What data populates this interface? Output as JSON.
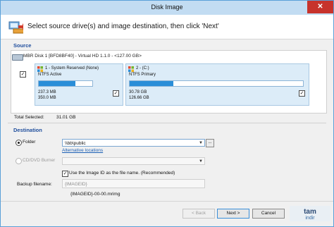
{
  "window": {
    "title": "Disk Image",
    "close_glyph": "✕"
  },
  "header": {
    "instruction": "Select source drive(s) and image destination, then click 'Next'",
    "icon": "wizard-icon"
  },
  "source": {
    "section_label": "Source",
    "disk": {
      "label": "MBR Disk 1 [BFD8BF40] - Virtual HD 1.1.0  -  <127.00 GB>",
      "checked": true
    },
    "partitions": [
      {
        "name": "1 - System Reserved (None)",
        "fs": "NTFS Active",
        "used": "237.3 MB",
        "total": "350.0 MB",
        "fill_percent": 68,
        "checked": true
      },
      {
        "name": "2 - (C:)",
        "fs": "NTFS Primary",
        "used": "30.78 GB",
        "total": "126.66 GB",
        "fill_percent": 25,
        "checked": true
      }
    ],
    "total_selected_label": "Total Selected:",
    "total_selected_value": "31.01 GB"
  },
  "destination": {
    "section_label": "Destination",
    "folder_label": "Folder",
    "folder_value": "\\\\bb\\public",
    "browse_label": "...",
    "alternative_locations": "Alternative locations",
    "cd_dvd_label": "CD/DVD Burner",
    "use_image_id_label": "Use the Image ID as the file name.  (Recommended)",
    "use_image_id_checked": true,
    "backup_filename_label": "Backup filename:",
    "backup_filename_value": "{IMAGEID}",
    "filename_preview": "{IMAGEID}-00-00.mrimg"
  },
  "footer": {
    "back": "< Back",
    "next": "Next >",
    "cancel": "Cancel"
  },
  "watermark": {
    "text": "tamindir"
  },
  "colors": {
    "accent": "#2a8ed8",
    "title_bar": "#c2dcf2",
    "section_label": "#1f4e9d",
    "close": "#c7332c"
  }
}
